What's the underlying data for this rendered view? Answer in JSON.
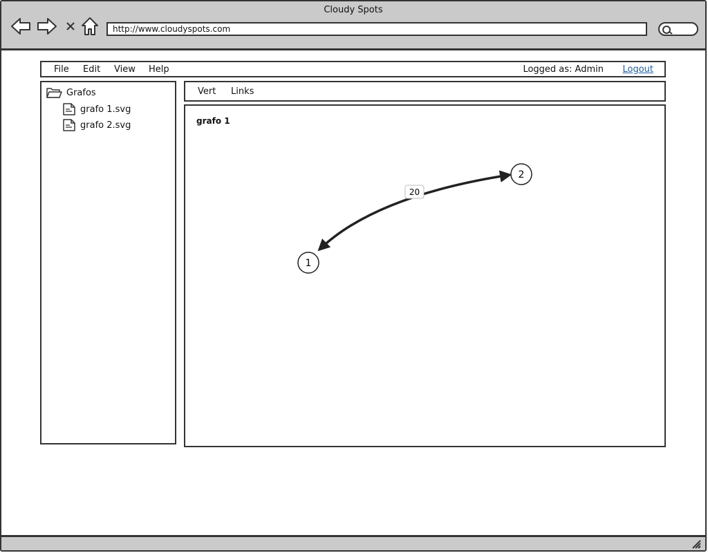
{
  "window": {
    "title": "Cloudy Spots"
  },
  "browser": {
    "url": "http://www.cloudyspots.com"
  },
  "menu": {
    "items": [
      "File",
      "Edit",
      "View",
      "Help"
    ],
    "logged_as": "Logged as: Admin",
    "logout": "Logout"
  },
  "tree": {
    "root": "Grafos",
    "files": [
      "grafo 1.svg",
      "grafo 2.svg"
    ]
  },
  "tabs": [
    "Vert",
    "Links"
  ],
  "graph": {
    "title": "grafo 1",
    "nodes": [
      {
        "label": "1"
      },
      {
        "label": "2"
      }
    ],
    "edge": {
      "from": "2",
      "to": "1",
      "weight": "20",
      "bidirectional": true
    }
  }
}
